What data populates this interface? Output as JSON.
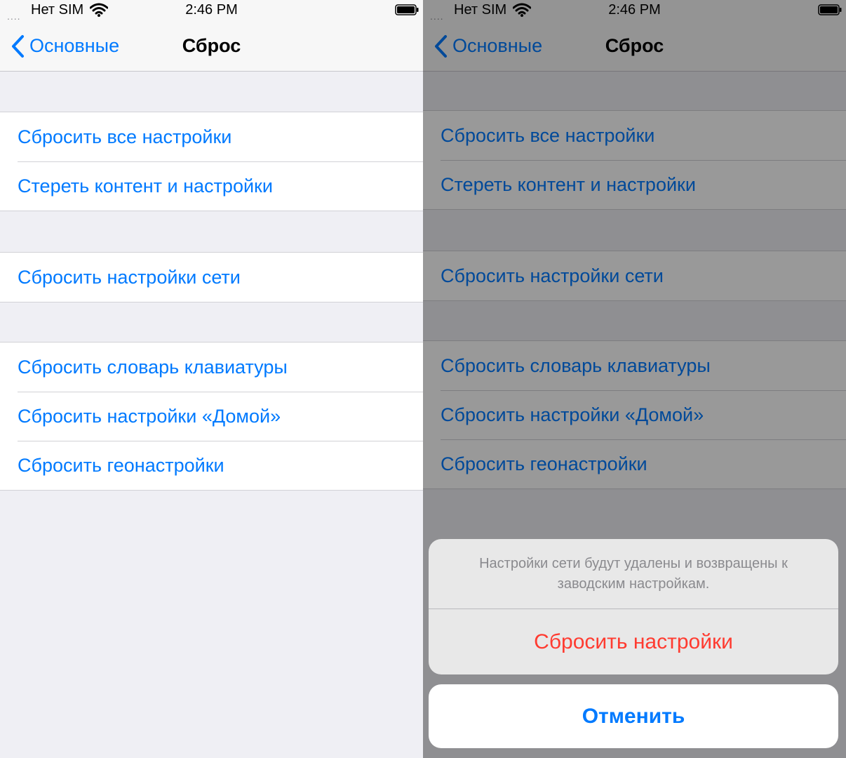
{
  "status": {
    "signal": "....",
    "carrier": "Нет SIM",
    "time": "2:46 PM"
  },
  "nav": {
    "back_label": "Основные",
    "title": "Сброс"
  },
  "groups": [
    [
      "Сбросить все настройки",
      "Стереть контент и настройки"
    ],
    [
      "Сбросить настройки сети"
    ],
    [
      "Сбросить словарь клавиатуры",
      "Сбросить настройки «Домой»",
      "Сбросить геонастройки"
    ]
  ],
  "action_sheet": {
    "message": "Настройки сети будут удалены и возвращены к заводским настройкам.",
    "destructive_label": "Сбросить настройки",
    "cancel_label": "Отменить"
  },
  "colors": {
    "accent": "#007aff",
    "destructive": "#ff3b30",
    "background": "#efeff4"
  }
}
